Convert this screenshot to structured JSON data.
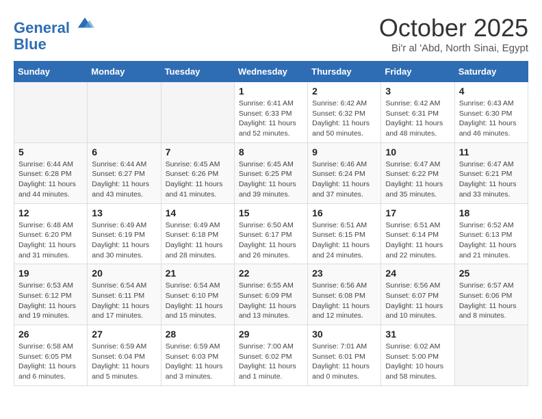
{
  "header": {
    "logo_line1": "General",
    "logo_line2": "Blue",
    "month_title": "October 2025",
    "location": "Bi'r al 'Abd, North Sinai, Egypt"
  },
  "weekdays": [
    "Sunday",
    "Monday",
    "Tuesday",
    "Wednesday",
    "Thursday",
    "Friday",
    "Saturday"
  ],
  "weeks": [
    [
      {
        "day": "",
        "detail": ""
      },
      {
        "day": "",
        "detail": ""
      },
      {
        "day": "",
        "detail": ""
      },
      {
        "day": "1",
        "detail": "Sunrise: 6:41 AM\nSunset: 6:33 PM\nDaylight: 11 hours\nand 52 minutes."
      },
      {
        "day": "2",
        "detail": "Sunrise: 6:42 AM\nSunset: 6:32 PM\nDaylight: 11 hours\nand 50 minutes."
      },
      {
        "day": "3",
        "detail": "Sunrise: 6:42 AM\nSunset: 6:31 PM\nDaylight: 11 hours\nand 48 minutes."
      },
      {
        "day": "4",
        "detail": "Sunrise: 6:43 AM\nSunset: 6:30 PM\nDaylight: 11 hours\nand 46 minutes."
      }
    ],
    [
      {
        "day": "5",
        "detail": "Sunrise: 6:44 AM\nSunset: 6:28 PM\nDaylight: 11 hours\nand 44 minutes."
      },
      {
        "day": "6",
        "detail": "Sunrise: 6:44 AM\nSunset: 6:27 PM\nDaylight: 11 hours\nand 43 minutes."
      },
      {
        "day": "7",
        "detail": "Sunrise: 6:45 AM\nSunset: 6:26 PM\nDaylight: 11 hours\nand 41 minutes."
      },
      {
        "day": "8",
        "detail": "Sunrise: 6:45 AM\nSunset: 6:25 PM\nDaylight: 11 hours\nand 39 minutes."
      },
      {
        "day": "9",
        "detail": "Sunrise: 6:46 AM\nSunset: 6:24 PM\nDaylight: 11 hours\nand 37 minutes."
      },
      {
        "day": "10",
        "detail": "Sunrise: 6:47 AM\nSunset: 6:22 PM\nDaylight: 11 hours\nand 35 minutes."
      },
      {
        "day": "11",
        "detail": "Sunrise: 6:47 AM\nSunset: 6:21 PM\nDaylight: 11 hours\nand 33 minutes."
      }
    ],
    [
      {
        "day": "12",
        "detail": "Sunrise: 6:48 AM\nSunset: 6:20 PM\nDaylight: 11 hours\nand 31 minutes."
      },
      {
        "day": "13",
        "detail": "Sunrise: 6:49 AM\nSunset: 6:19 PM\nDaylight: 11 hours\nand 30 minutes."
      },
      {
        "day": "14",
        "detail": "Sunrise: 6:49 AM\nSunset: 6:18 PM\nDaylight: 11 hours\nand 28 minutes."
      },
      {
        "day": "15",
        "detail": "Sunrise: 6:50 AM\nSunset: 6:17 PM\nDaylight: 11 hours\nand 26 minutes."
      },
      {
        "day": "16",
        "detail": "Sunrise: 6:51 AM\nSunset: 6:15 PM\nDaylight: 11 hours\nand 24 minutes."
      },
      {
        "day": "17",
        "detail": "Sunrise: 6:51 AM\nSunset: 6:14 PM\nDaylight: 11 hours\nand 22 minutes."
      },
      {
        "day": "18",
        "detail": "Sunrise: 6:52 AM\nSunset: 6:13 PM\nDaylight: 11 hours\nand 21 minutes."
      }
    ],
    [
      {
        "day": "19",
        "detail": "Sunrise: 6:53 AM\nSunset: 6:12 PM\nDaylight: 11 hours\nand 19 minutes."
      },
      {
        "day": "20",
        "detail": "Sunrise: 6:54 AM\nSunset: 6:11 PM\nDaylight: 11 hours\nand 17 minutes."
      },
      {
        "day": "21",
        "detail": "Sunrise: 6:54 AM\nSunset: 6:10 PM\nDaylight: 11 hours\nand 15 minutes."
      },
      {
        "day": "22",
        "detail": "Sunrise: 6:55 AM\nSunset: 6:09 PM\nDaylight: 11 hours\nand 13 minutes."
      },
      {
        "day": "23",
        "detail": "Sunrise: 6:56 AM\nSunset: 6:08 PM\nDaylight: 11 hours\nand 12 minutes."
      },
      {
        "day": "24",
        "detail": "Sunrise: 6:56 AM\nSunset: 6:07 PM\nDaylight: 11 hours\nand 10 minutes."
      },
      {
        "day": "25",
        "detail": "Sunrise: 6:57 AM\nSunset: 6:06 PM\nDaylight: 11 hours\nand 8 minutes."
      }
    ],
    [
      {
        "day": "26",
        "detail": "Sunrise: 6:58 AM\nSunset: 6:05 PM\nDaylight: 11 hours\nand 6 minutes."
      },
      {
        "day": "27",
        "detail": "Sunrise: 6:59 AM\nSunset: 6:04 PM\nDaylight: 11 hours\nand 5 minutes."
      },
      {
        "day": "28",
        "detail": "Sunrise: 6:59 AM\nSunset: 6:03 PM\nDaylight: 11 hours\nand 3 minutes."
      },
      {
        "day": "29",
        "detail": "Sunrise: 7:00 AM\nSunset: 6:02 PM\nDaylight: 11 hours\nand 1 minute."
      },
      {
        "day": "30",
        "detail": "Sunrise: 7:01 AM\nSunset: 6:01 PM\nDaylight: 11 hours\nand 0 minutes."
      },
      {
        "day": "31",
        "detail": "Sunrise: 6:02 AM\nSunset: 5:00 PM\nDaylight: 10 hours\nand 58 minutes."
      },
      {
        "day": "",
        "detail": ""
      }
    ]
  ]
}
